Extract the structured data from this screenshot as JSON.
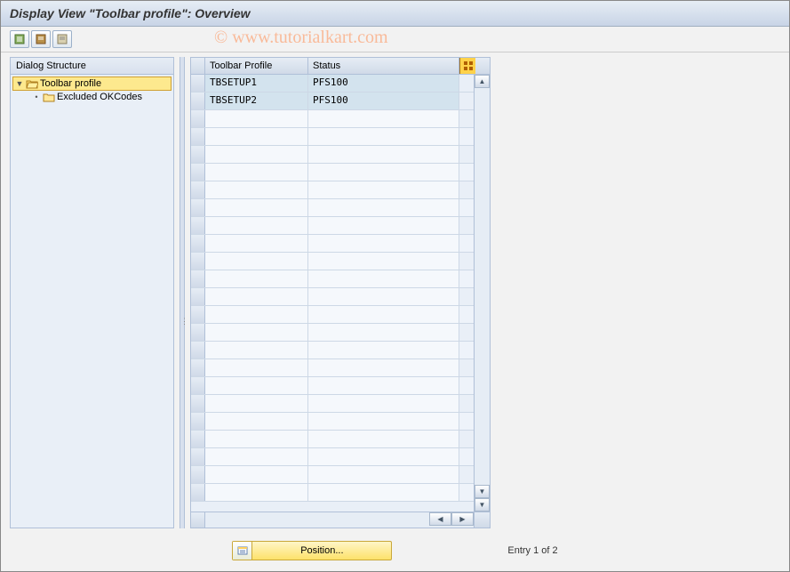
{
  "title": "Display View \"Toolbar profile\": Overview",
  "watermark": "© www.tutorialkart.com",
  "toolbar_icons": [
    "detail-icon",
    "expand-icon",
    "collapse-icon"
  ],
  "tree": {
    "header": "Dialog Structure",
    "root": {
      "label": "Toolbar profile",
      "expanded": true,
      "selected": true
    },
    "child": {
      "label": "Excluded OKCodes",
      "expanded": false,
      "selected": false
    }
  },
  "table": {
    "columns": [
      "Toolbar Profile",
      "Status"
    ],
    "rows": [
      {
        "profile": "TBSETUP1",
        "status": "PFS100"
      },
      {
        "profile": "TBSETUP2",
        "status": "PFS100"
      }
    ],
    "empty_rows": 22
  },
  "footer": {
    "position_label": "Position...",
    "entry_text": "Entry 1 of 2"
  }
}
